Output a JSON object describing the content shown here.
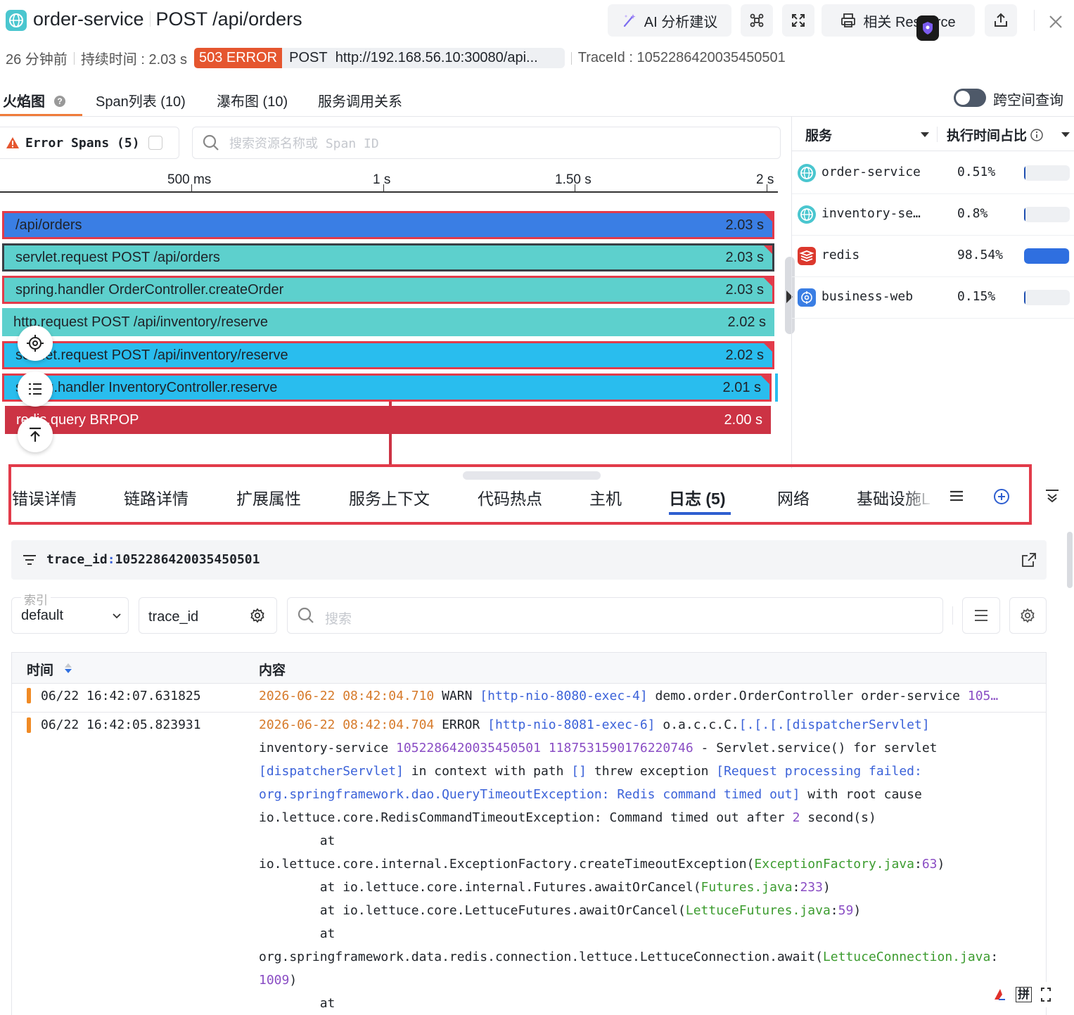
{
  "header": {
    "service": "order-service",
    "endpoint": "POST /api/orders",
    "ai_button": "AI 分析建议",
    "related_button": "相关 Resource"
  },
  "meta": {
    "time_ago": "26 分钟前",
    "duration": "持续时间 : 2.03 s",
    "error_badge": "503 ERROR",
    "method": "POST",
    "url": "http://192.168.56.10:30080/api...",
    "trace_id": "TraceId : 1052286420035450501"
  },
  "tabs": {
    "flame": "火焰图",
    "span_list": "Span列表 (10)",
    "waterfall": "瀑布图 (10)",
    "service_calls": "服务调用关系",
    "cross_space": "跨空间查询"
  },
  "filter": {
    "error_spans": "Error Spans (5)",
    "search_placeholder": "搜索资源名称或 Span ID"
  },
  "axis": {
    "ticks": [
      "500 ms",
      "1 s",
      "1.50 s",
      "2 s"
    ]
  },
  "flame_bars": [
    {
      "name": "/api/orders",
      "duration": "2.03 s",
      "color": "#3a7ee4"
    },
    {
      "name": "servlet.request POST /api/orders",
      "duration": "2.03 s",
      "color": "#5dd0cd"
    },
    {
      "name": "spring.handler OrderController.createOrder",
      "duration": "2.03 s",
      "color": "#5dd0cd"
    },
    {
      "name": "http.request POST /api/inventory/reserve",
      "duration": "2.02 s",
      "color": "#5dd0cd"
    },
    {
      "name": "servlet.request POST /api/inventory/reserve",
      "duration": "2.02 s",
      "color": "#29bdee"
    },
    {
      "name": "spring.handler InventoryController.reserve",
      "duration": "2.01 s",
      "color": "#29bdee"
    },
    {
      "name": "redis.query BRPOP",
      "duration": "2.00 s",
      "color": "#cc3344"
    }
  ],
  "services_panel": {
    "col_service": "服务",
    "col_ratio": "执行时间占比",
    "rows": [
      {
        "name": "order-service",
        "pct": "0.51%",
        "ratio": 0.0051,
        "icon": "globe-icon"
      },
      {
        "name": "inventory-se…",
        "pct": "0.8%",
        "ratio": 0.008,
        "icon": "globe-icon"
      },
      {
        "name": "redis",
        "pct": "98.54%",
        "ratio": 0.9854,
        "icon": "redis-icon"
      },
      {
        "name": "business-web",
        "pct": "0.15%",
        "ratio": 0.0015,
        "icon": "web-icon"
      }
    ]
  },
  "detail_tabs": [
    "错误详情",
    "链路详情",
    "扩展属性",
    "服务上下文",
    "代码热点",
    "主机",
    "日志 (5)",
    "网络",
    "基础设施L"
  ],
  "logs": {
    "query_key": "trace_id",
    "query_value": "1052286420035450501",
    "index_label": "索引",
    "index_value": "default",
    "field": "trace_id",
    "search_placeholder": "搜索",
    "col_time": "时间",
    "col_content": "内容",
    "rows": [
      {
        "time": "06/22 16:42:07.631825",
        "level_color": "#f08a24"
      },
      {
        "time": "06/22 16:42:05.823931",
        "level_color": "#f08a24"
      }
    ]
  },
  "ime": {
    "label": "拼"
  }
}
